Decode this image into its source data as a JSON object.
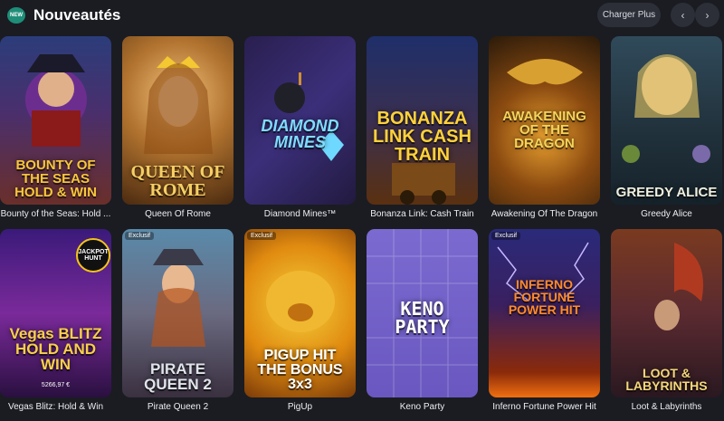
{
  "header": {
    "badge": "NEW",
    "title": "Nouveautés",
    "load_more": "Charger Plus",
    "prev": "‹",
    "next": "›"
  },
  "games": [
    {
      "caption": "Bounty of the Seas: Hold ...",
      "art_title": "BOUNTY OF THE SEAS HOLD & WIN",
      "exclusive": ""
    },
    {
      "caption": "Queen Of Rome",
      "art_title": "QUEEN OF ROME",
      "exclusive": ""
    },
    {
      "caption": "Diamond Mines™",
      "art_title": "DIAMOND MINES",
      "exclusive": ""
    },
    {
      "caption": "Bonanza Link: Cash Train",
      "art_title": "BONANZA LINK CASH TRAIN",
      "exclusive": ""
    },
    {
      "caption": "Awakening Of The Dragon",
      "art_title": "AWAKENING OF THE DRAGON",
      "exclusive": ""
    },
    {
      "caption": "Greedy Alice",
      "art_title": "GREEDY ALICE",
      "exclusive": ""
    },
    {
      "caption": "Vegas Blitz: Hold & Win",
      "art_title": "Vegas BLITZ HOLD AND WIN",
      "exclusive": "",
      "jackpot": "JACKPOT HUNT",
      "amount": "5266,97 €"
    },
    {
      "caption": "Pirate Queen 2",
      "art_title": "PIRATE QUEEN 2",
      "exclusive": "Exclusif"
    },
    {
      "caption": "PigUp",
      "art_title": "PIGUP HIT THE BONUS 3x3",
      "exclusive": "Exclusif"
    },
    {
      "caption": "Keno Party",
      "art_title": "KENO PARTY",
      "exclusive": ""
    },
    {
      "caption": "Inferno Fortune Power Hit",
      "art_title": "INFERNO FORTUNE POWER HIT",
      "exclusive": "Exclusif"
    },
    {
      "caption": "Loot & Labyrinths",
      "art_title": "LOOT & LABYRINTHS",
      "exclusive": ""
    }
  ],
  "colors": {
    "background": "#1a1c22",
    "button": "#2c2f38",
    "badge": "#1f8e79"
  }
}
